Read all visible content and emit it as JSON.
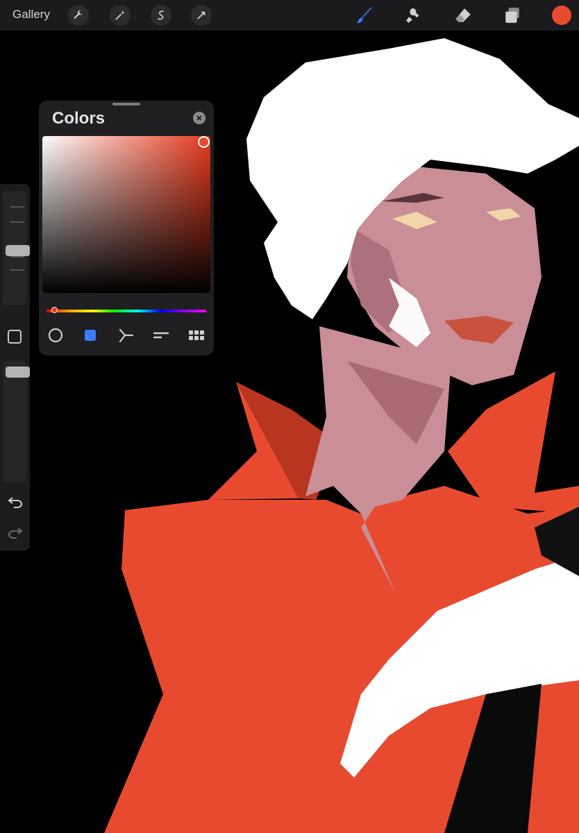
{
  "toolbar": {
    "gallery_label": "Gallery",
    "left_tools": [
      "wrench-icon",
      "magic-wand-icon",
      "selection-s-icon",
      "transform-arrow-icon"
    ],
    "right_tools": [
      "brush-icon",
      "smudge-icon",
      "eraser-icon",
      "layers-icon"
    ],
    "current_color": "#e84a2f",
    "active_tool": "brush",
    "active_color": "#3a7bff"
  },
  "sidebar": {
    "brush_size_level": 0.52,
    "opacity_level": 0.0,
    "buttons": [
      "modify-square-icon",
      "undo-icon",
      "redo-icon"
    ]
  },
  "colors_panel": {
    "title": "Colors",
    "picker_hue_color": "#e8391d",
    "handle_saturation": 0.88,
    "handle_brightness": 1.0,
    "hue_fraction": 0.05,
    "modes": [
      "disc-icon",
      "classic-square-icon",
      "harmony-icon",
      "value-sliders-icon",
      "palettes-grid-icon"
    ],
    "selected_mode": 1
  },
  "artwork": {
    "palette": {
      "background": "#000000",
      "coat": "#e84a2f",
      "coat_shadow": "#b83520",
      "hair": "#ffffff",
      "skin": "#c98e96",
      "skin_shadow": "#9d5d63",
      "lip": "#c9523f"
    }
  }
}
